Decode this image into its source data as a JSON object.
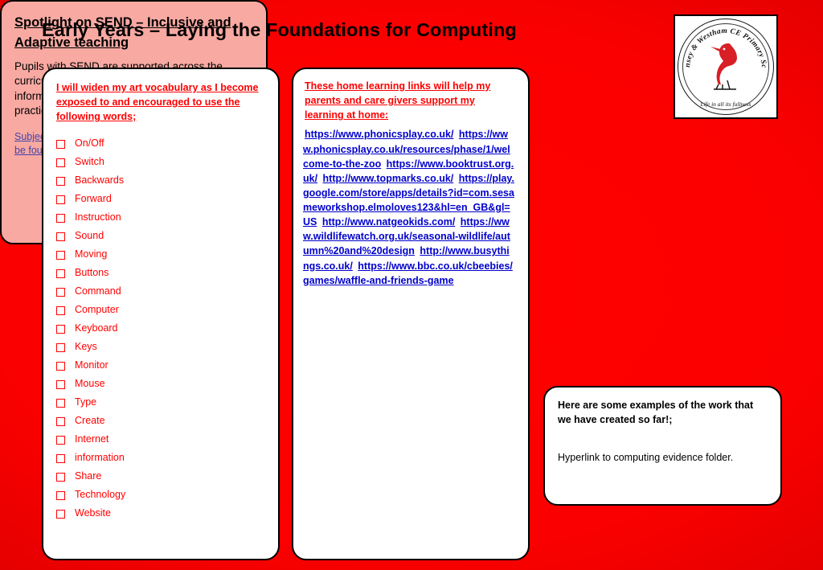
{
  "slide": {
    "title": "Early Years – Laying the Foundations for Computing"
  },
  "logo": {
    "name": "westham-ce-primary-school-logo",
    "arc_text_top": "Pevensey & Westham CE Primary School",
    "motto": "Life in all its fullness",
    "icon": "heron-bird-icon"
  },
  "vocabulary": {
    "heading": "I will widen my art vocabulary as I become exposed to and encouraged to use the following words;",
    "words": [
      "On/Off",
      "Switch",
      "Backwards",
      "Forward",
      "Instruction",
      "Sound",
      "Moving",
      "Buttons",
      "Command",
      "Computer",
      "Keyboard",
      "Keys",
      "Monitor",
      "Mouse",
      "Type",
      "Create",
      "Internet",
      "information",
      "Share",
      "Technology",
      "Website"
    ]
  },
  "links": {
    "heading": "These home learning links will help my parents and care givers support my learning at home:",
    "items": [
      "https://www.phonicsplay.co.uk/",
      "https://www.phonicsplay.co.uk/resources/phase/1/welcome-to-the-zoo",
      "https://www.booktrust.org.uk/",
      "http://www.topmarks.co.uk/",
      "https://play.google.com/store/apps/details?id=com.sesameworkshop.elmoloves123&hl=en_GB&gl=US",
      "http://www.natgeokids.com/",
      "https://www.wildlifewatch.org.uk/seasonal-wildlife/autumn%20and%20design",
      "http://www.busythings.co.uk/",
      "https://www.bbc.co.uk/cbeebies/games/waffle-and-friends-game"
    ]
  },
  "send": {
    "heading": "Spotlight on SEND – Inclusive and Adaptive teaching",
    "body": "Pupils with SEND are supported across the curriculum through Quality First Teaching informed by Inclusive and Adaptive teaching practices.  This is part of our universal offer.",
    "link": "Subject specific inclusive and adaptive strategies can be found here."
  },
  "examples": {
    "heading": "Here are some examples of the work that we have created so far!;",
    "body": "Hyperlink to computing evidence folder."
  },
  "colors": {
    "background_red": "#ff0000",
    "vocab_text": "#ff0000",
    "link_text": "#0000cc",
    "send_panel": "#f8a9a2",
    "send_link": "#4444aa"
  }
}
